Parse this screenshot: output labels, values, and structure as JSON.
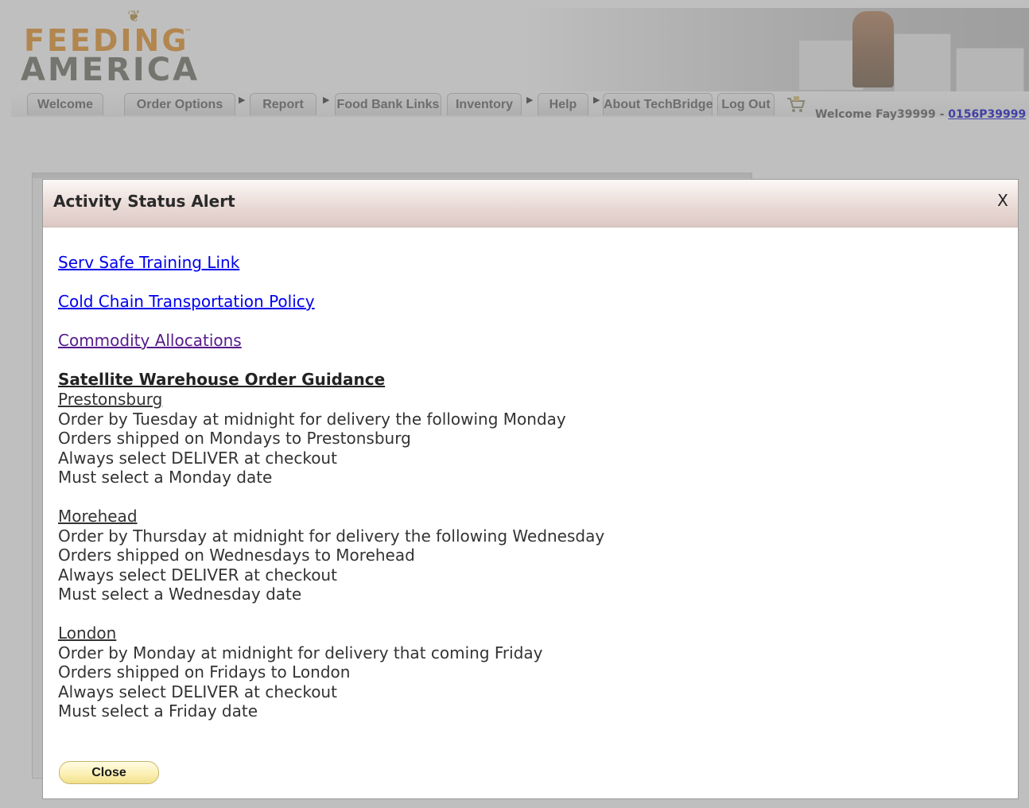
{
  "logo": {
    "line1": "FEEDING",
    "tm": "™",
    "line2": "AMERICA"
  },
  "nav": {
    "tabs": [
      {
        "label": "Welcome"
      },
      {
        "label": "Order Options"
      },
      {
        "label": "Report"
      },
      {
        "label": "Food Bank Links"
      },
      {
        "label": "Inventory"
      },
      {
        "label": "Help"
      },
      {
        "label": "About TechBridge"
      },
      {
        "label": "Log Out"
      }
    ],
    "arrow": "▶",
    "welcome_prefix": "Welcome Fay39999 - ",
    "account_link": "0156P39999"
  },
  "modal": {
    "title": "Activity Status Alert",
    "close_x": "X",
    "links": [
      {
        "label": "Serv Safe Training Link"
      },
      {
        "label": "Cold Chain Transportation Policy"
      },
      {
        "label": "Commodity Allocations"
      }
    ],
    "guidance_heading": "Satellite Warehouse Order Guidance",
    "locations": [
      {
        "name": "Prestonsburg",
        "lines": [
          "Order by Tuesday at midnight for delivery the following Monday",
          "Orders shipped on Mondays to Prestonsburg",
          "Always select DELIVER at checkout",
          "Must select a Monday date"
        ]
      },
      {
        "name": "Morehead",
        "lines": [
          "Order by Thursday at midnight for delivery the following Wednesday",
          "Orders shipped on Wednesdays to Morehead",
          "Always select DELIVER at checkout",
          "Must select a Wednesday date"
        ]
      },
      {
        "name": "London",
        "lines": [
          "Order by Monday at midnight for delivery that coming Friday",
          "Orders shipped on Fridays to London",
          "Always select DELIVER at checkout",
          "Must select a Friday date"
        ]
      }
    ],
    "close_button": "Close"
  },
  "colors": {
    "logo_orange": "#e48c1e",
    "logo_gray": "#6b6b5e",
    "link_blue": "#0000ee",
    "link_visited": "#551a8b",
    "close_button_yellow": "#fbefb1"
  }
}
